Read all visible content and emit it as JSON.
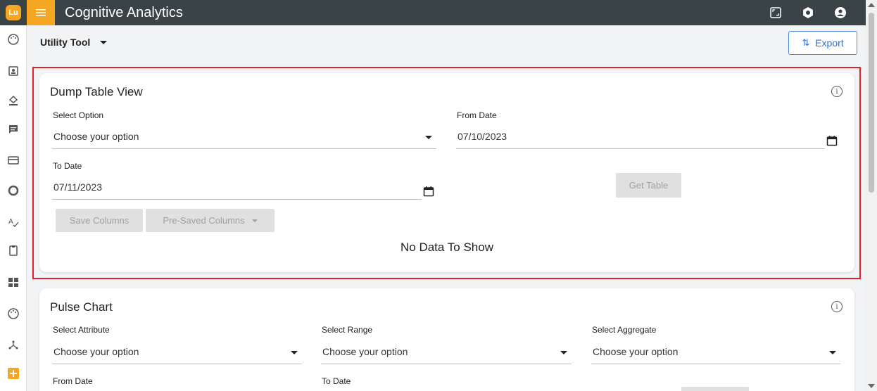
{
  "app": {
    "logo_text": "Lu",
    "title": "Cognitive Analytics"
  },
  "rail_icons": [
    "palette-icon",
    "person-card-icon",
    "paint-bucket-icon",
    "chat-icon",
    "card-icon",
    "circle-icon",
    "spellcheck-icon",
    "clipboard-icon",
    "dashboard-icon",
    "palette-icon",
    "hub-icon",
    "add-icon"
  ],
  "topbar_icons": [
    "fullscreen-icon",
    "settings-icon",
    "account-icon"
  ],
  "header": {
    "tool_label": "Utility Tool",
    "export_label": "Export"
  },
  "dump_table": {
    "title": "Dump Table View",
    "select_option_label": "Select Option",
    "select_option_value": "Choose your option",
    "from_date_label": "From Date",
    "from_date_value": "07/10/2023",
    "to_date_label": "To Date",
    "to_date_value": "07/11/2023",
    "get_table_label": "Get Table",
    "save_columns_label": "Save Columns",
    "pre_saved_columns_label": "Pre-Saved Columns",
    "empty_message": "No Data To Show"
  },
  "pulse_chart": {
    "title": "Pulse Chart",
    "select_attribute_label": "Select Attribute",
    "select_attribute_value": "Choose your option",
    "select_range_label": "Select Range",
    "select_range_value": "Choose your option",
    "select_aggregate_label": "Select Aggregate",
    "select_aggregate_value": "Choose your option",
    "from_date_label": "From Date",
    "to_date_label": "To Date"
  },
  "colors": {
    "topbar": "#3a4346",
    "accent": "#f5a623",
    "highlight": "#e3212d",
    "export": "#2f6fd0"
  }
}
